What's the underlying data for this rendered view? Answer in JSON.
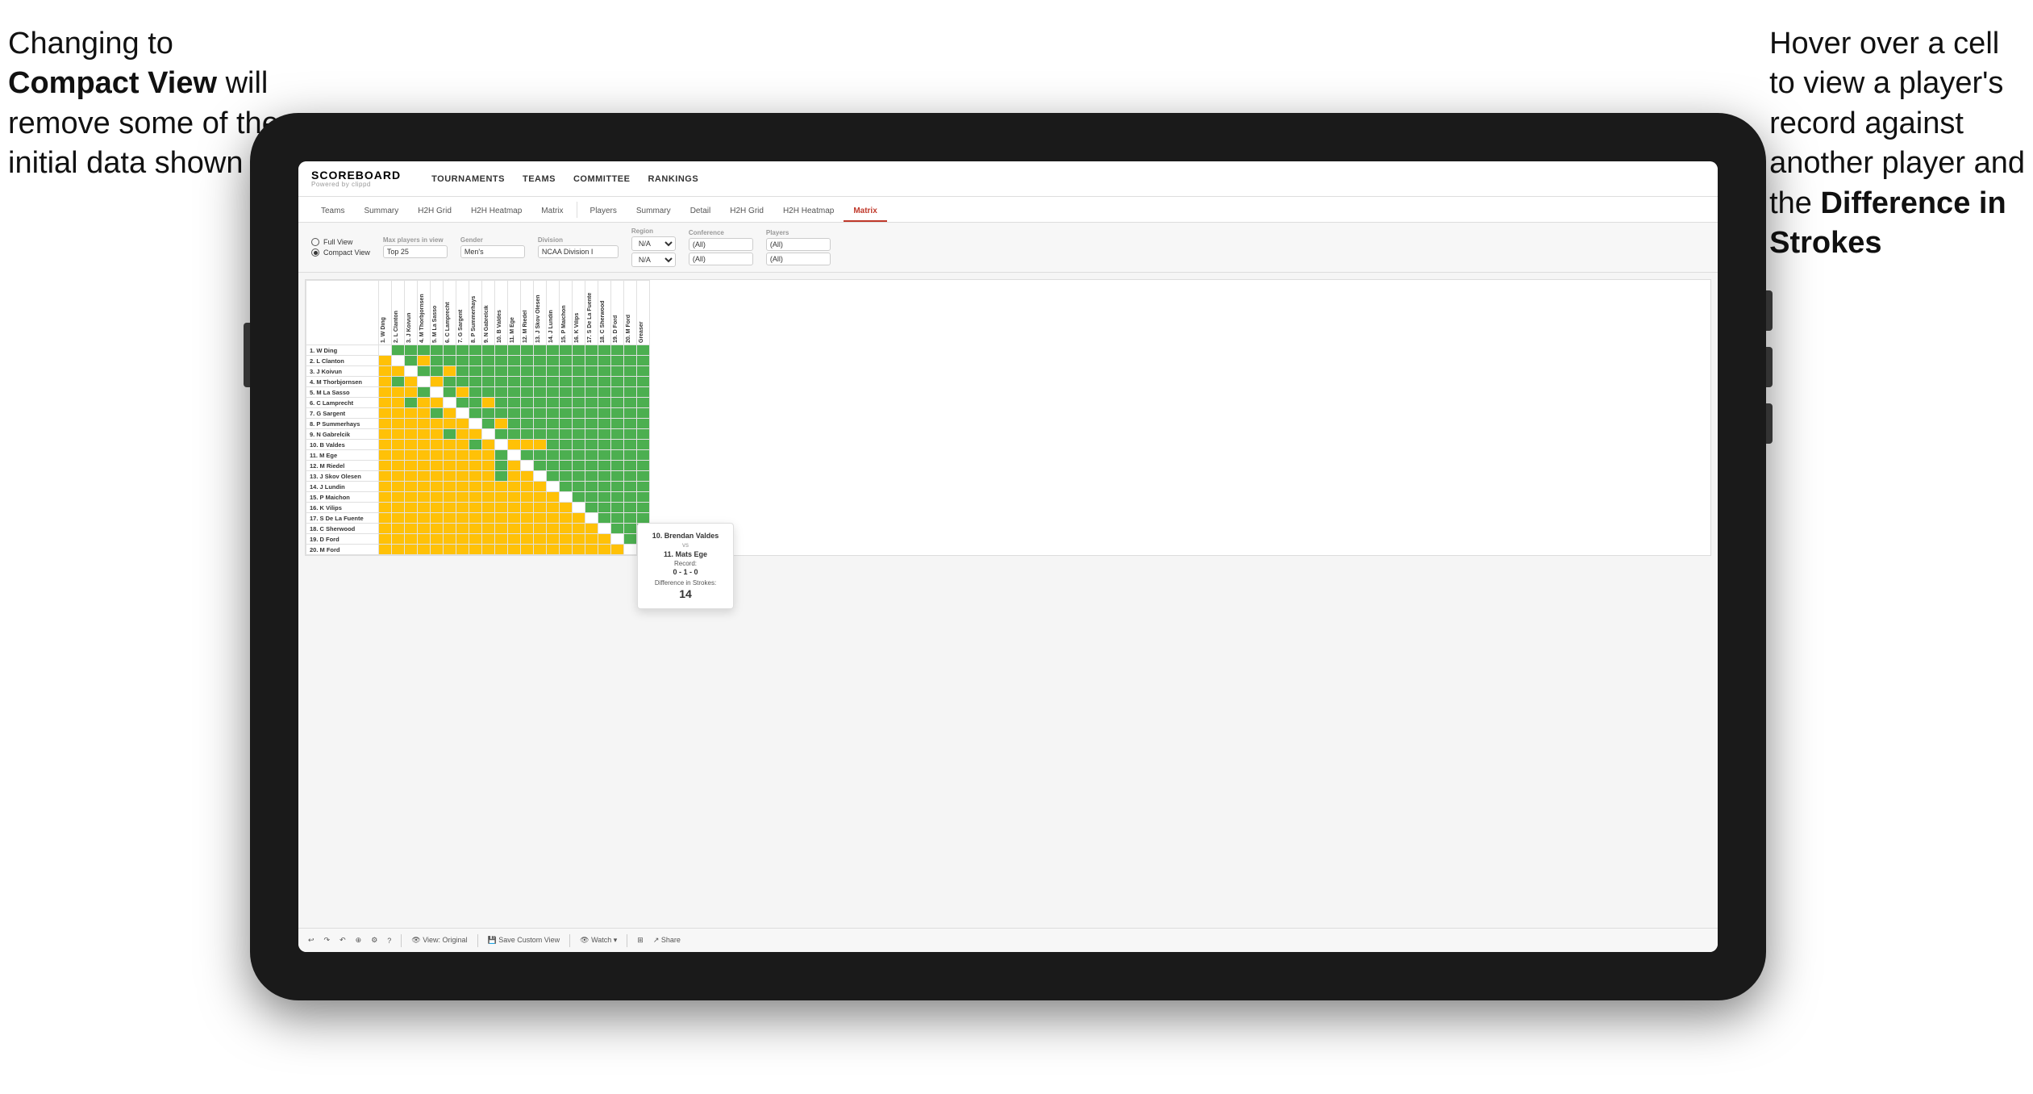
{
  "annotations": {
    "left": {
      "line1": "Changing to",
      "line2_bold": "Compact View",
      "line2_rest": " will",
      "line3": "remove some of the",
      "line4": "initial data shown"
    },
    "right": {
      "line1": "Hover over a cell",
      "line2": "to view a player's",
      "line3": "record against",
      "line4": "another player and",
      "line5_pre": "the ",
      "line5_bold": "Difference in",
      "line6_bold": "Strokes"
    }
  },
  "nav": {
    "logo_title": "SCOREBOARD",
    "logo_sub": "Powered by clippd",
    "links": [
      "TOURNAMENTS",
      "TEAMS",
      "COMMITTEE",
      "RANKINGS"
    ]
  },
  "tabs": {
    "group1": [
      "Teams",
      "Summary",
      "H2H Grid",
      "H2H Heatmap",
      "Matrix"
    ],
    "group2": [
      "Players",
      "Summary",
      "Detail",
      "H2H Grid",
      "H2H Heatmap",
      "Matrix"
    ],
    "active": "Matrix"
  },
  "filters": {
    "view_full": "Full View",
    "view_compact": "Compact View",
    "view_selected": "compact",
    "max_players_label": "Max players in view",
    "max_players_value": "Top 25",
    "gender_label": "Gender",
    "gender_value": "Men's",
    "division_label": "Division",
    "division_value": "NCAA Division I",
    "region_label": "Region",
    "region_value1": "N/A",
    "region_value2": "N/A",
    "conference_label": "Conference",
    "conference_value1": "(All)",
    "conference_value2": "(All)",
    "players_label": "Players",
    "players_value1": "(All)",
    "players_value2": "(All)"
  },
  "column_headers": [
    "1. W Ding",
    "2. L Clanton",
    "3. J Koivun",
    "4. M Thorbjornsen",
    "5. M La Sasso",
    "6. C Lamprecht",
    "7. G Sargent",
    "8. P Summerhays",
    "9. N Gabrelcik",
    "10. B Valdes",
    "11. M Ege",
    "12. M Riedel",
    "13. J Skov Olesen",
    "14. J Lundin",
    "15. P Maichon",
    "16. K Vilips",
    "17. S De La Fuente",
    "18. C Sherwood",
    "19. D Ford",
    "20. M Ford",
    "Greaser"
  ],
  "row_players": [
    "1. W Ding",
    "2. L Clanton",
    "3. J Koivun",
    "4. M Thorbjornsen",
    "5. M La Sasso",
    "6. C Lamprecht",
    "7. G Sargent",
    "8. P Summerhays",
    "9. N Gabrelcik",
    "10. B Valdes",
    "11. M Ege",
    "12. M Riedel",
    "13. J Skov Olesen",
    "14. J Lundin",
    "15. P Maichon",
    "16. K Vilips",
    "17. S De La Fuente",
    "18. C Sherwood",
    "19. D Ford",
    "20. M Ford"
  ],
  "tooltip": {
    "player1": "10. Brendan Valdes",
    "vs": "vs",
    "player2": "11. Mats Ege",
    "record_label": "Record:",
    "record": "0 - 1 - 0",
    "diff_label": "Difference in Strokes:",
    "diff": "14"
  },
  "toolbar": {
    "undo": "↩",
    "redo": "↪",
    "view_original": "View: Original",
    "save_custom": "Save Custom View",
    "watch": "Watch ▾",
    "share": "Share"
  }
}
